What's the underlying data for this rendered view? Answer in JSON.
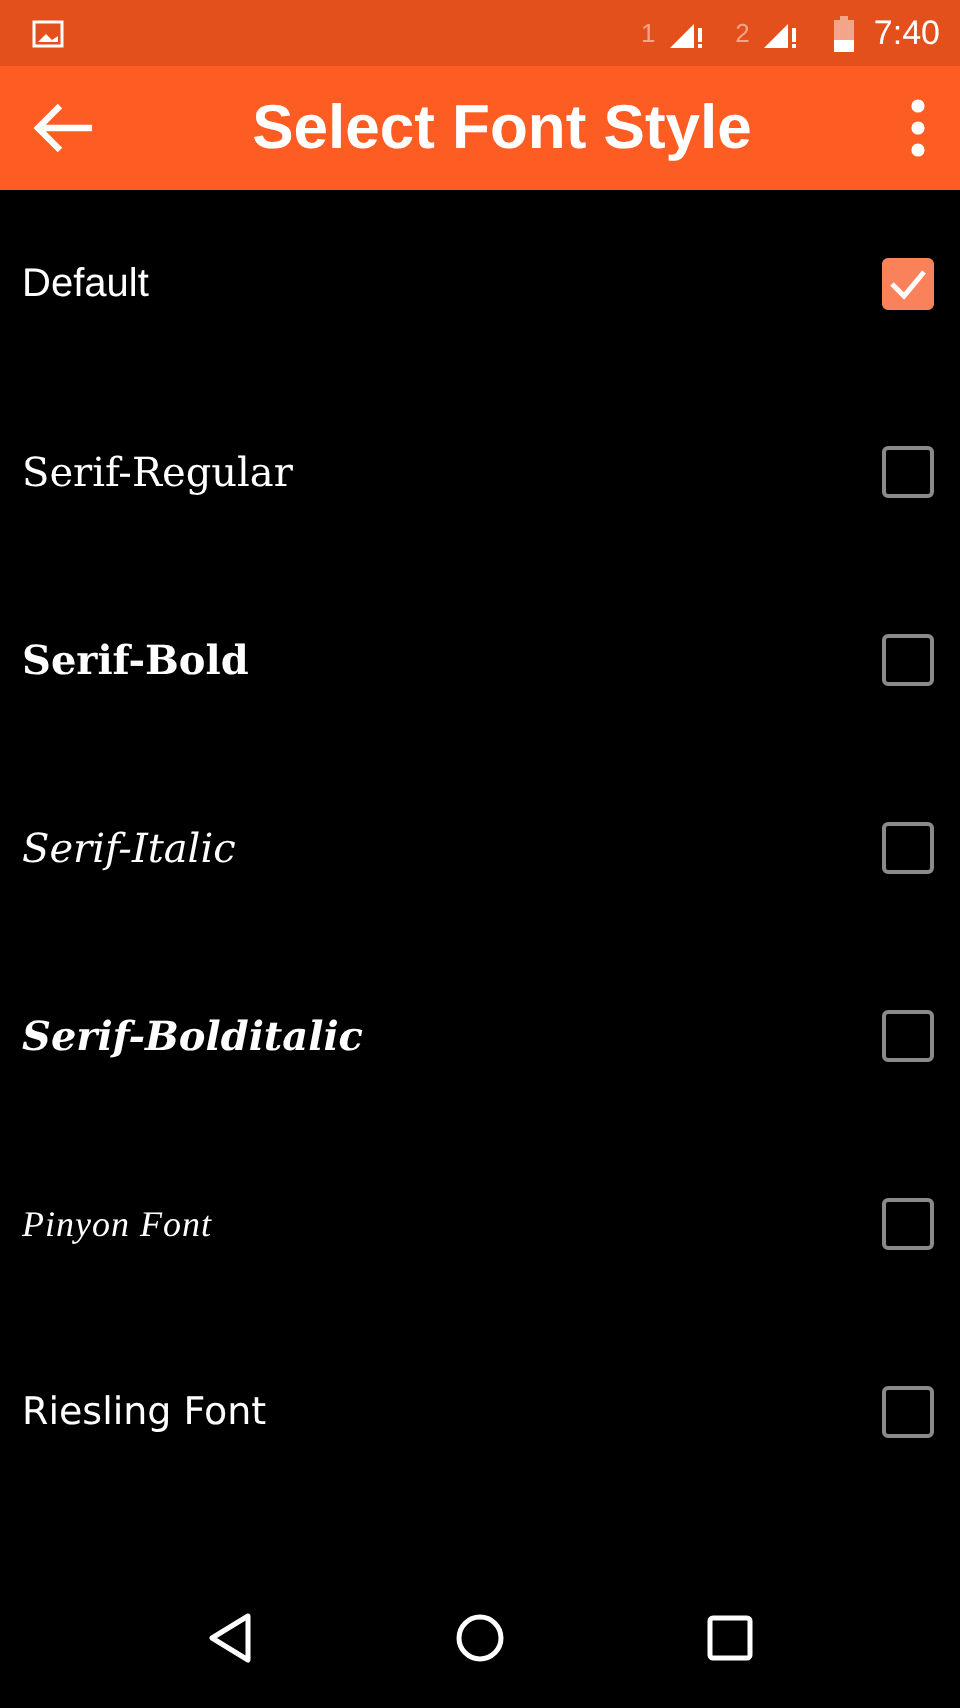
{
  "status_bar": {
    "sim_1": "1",
    "sim_2": "2",
    "time": "7:40"
  },
  "app_bar": {
    "title": "Select Font Style"
  },
  "fonts": [
    {
      "label": "Default",
      "kind": "sans",
      "checked": true
    },
    {
      "label": "Serif-Regular",
      "kind": "serif",
      "checked": false
    },
    {
      "label": "Serif-Bold",
      "kind": "serif-bold",
      "checked": false
    },
    {
      "label": "Serif-Italic",
      "kind": "serif-italic",
      "checked": false
    },
    {
      "label": "Serif-Bolditalic",
      "kind": "serif-bolditalic",
      "checked": false
    },
    {
      "label": "Pinyon Font",
      "kind": "script",
      "checked": false
    },
    {
      "label": "Riesling Font",
      "kind": "sans-alt",
      "checked": false
    }
  ]
}
